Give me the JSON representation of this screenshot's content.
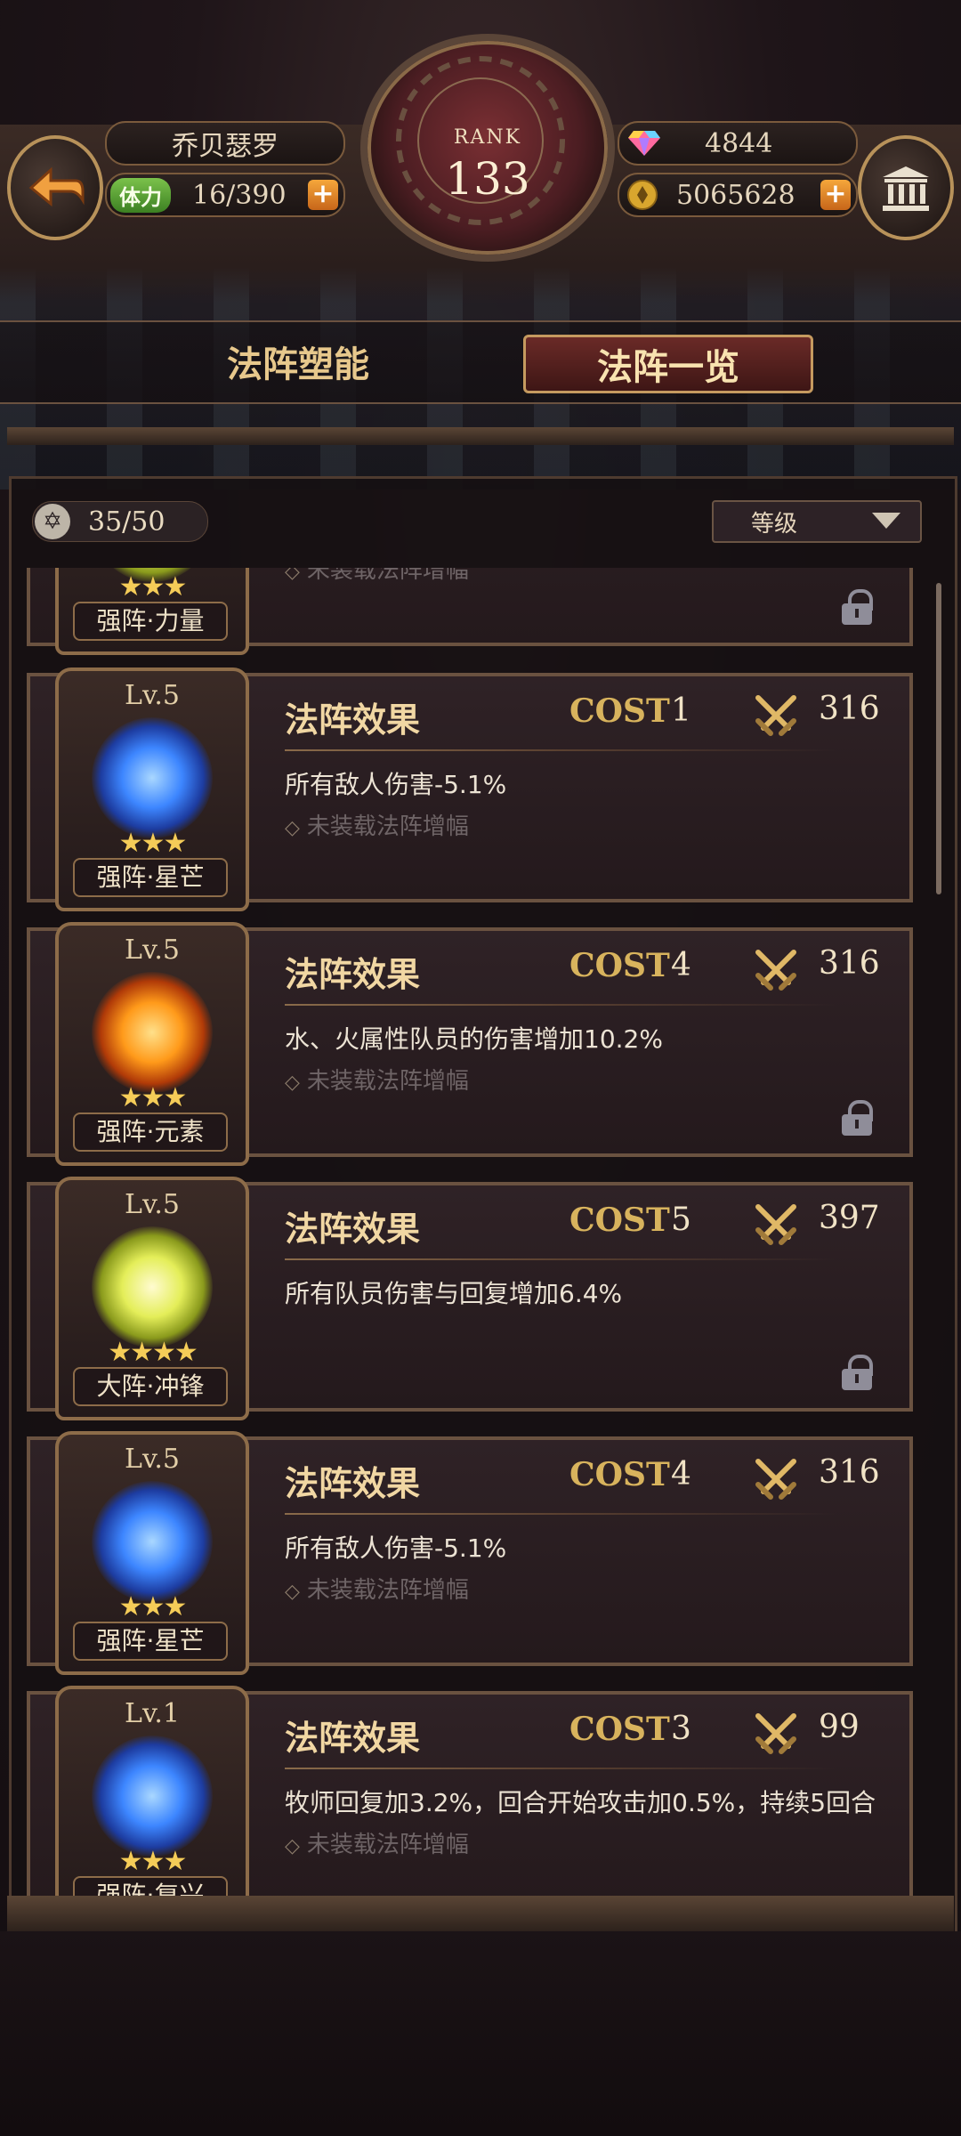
{
  "player": {
    "name": "乔贝瑟罗",
    "stamina_label": "体力",
    "stamina": "16/390",
    "gems": "4844",
    "gold": "5065628",
    "rank_label": "RANK",
    "rank": "133"
  },
  "tabs": [
    {
      "label": "法阵塑能",
      "active": false
    },
    {
      "label": "法阵一览",
      "active": true
    }
  ],
  "toolbar": {
    "count": "35/50",
    "sort": "等级"
  },
  "common": {
    "effect_title": "法阵效果",
    "cost_label": "COST",
    "slot_empty": "未装载法阵增幅"
  },
  "cards": [
    {
      "level": "",
      "name": "强阵·力量",
      "stars": "★★★",
      "orb": "gold",
      "cost": "",
      "power": "",
      "desc": "",
      "slot": "未装载法阵增幅",
      "locked": true
    },
    {
      "level": "Lv.5",
      "name": "强阵·星芒",
      "stars": "★★★",
      "orb": "blue",
      "cost": "1",
      "power": "316",
      "desc": "所有敌人伤害-5.1%",
      "slot": "未装载法阵增幅",
      "locked": false
    },
    {
      "level": "Lv.5",
      "name": "强阵·元素",
      "stars": "★★★",
      "orb": "fire",
      "cost": "4",
      "power": "316",
      "desc": "水、火属性队员的伤害增加10.2%",
      "slot": "未装载法阵增幅",
      "locked": true
    },
    {
      "level": "Lv.5",
      "name": "大阵·冲锋",
      "stars": "★★★★",
      "orb": "gold",
      "cost": "5",
      "power": "397",
      "desc": "所有队员伤害与回复增加6.4%",
      "slot": "",
      "locked": true
    },
    {
      "level": "Lv.5",
      "name": "强阵·星芒",
      "stars": "★★★",
      "orb": "blue",
      "cost": "4",
      "power": "316",
      "desc": "所有敌人伤害-5.1%",
      "slot": "未装载法阵增幅",
      "locked": false
    },
    {
      "level": "Lv.1",
      "name": "强阵·复兴",
      "stars": "★★★",
      "orb": "blue",
      "cost": "3",
      "power": "99",
      "desc": "牧师回复加3.2%，回合开始攻击加0.5%，持续5回合",
      "slot": "未装载法阵增幅",
      "locked": false
    }
  ]
}
